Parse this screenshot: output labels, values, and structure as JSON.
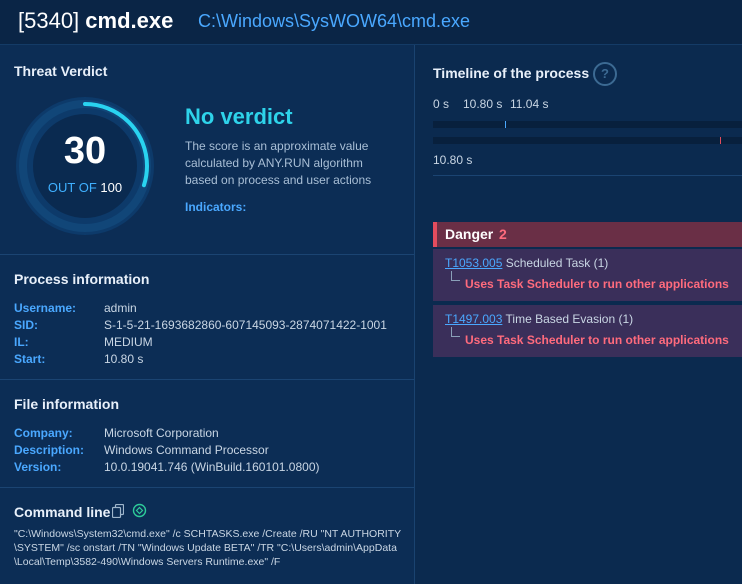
{
  "header": {
    "pid": "[5340]",
    "process_name": "cmd.exe",
    "path": "C:\\Windows\\SysWOW64\\cmd.exe"
  },
  "verdict": {
    "section_title": "Threat Verdict",
    "score": "30",
    "out_of_label": "OUT OF",
    "out_of_value": "100",
    "score_fraction": 0.3,
    "title": "No verdict",
    "description": "The score is an approximate value calculated by ANY.RUN algorithm based on process and user actions",
    "indicators_label": "Indicators:"
  },
  "process_info": {
    "section_title": "Process information",
    "rows": [
      {
        "key": "Username:",
        "value": "admin"
      },
      {
        "key": "SID:",
        "value": "S-1-5-21-1693682860-607145093-2874071422-1001"
      },
      {
        "key": "IL:",
        "value": "MEDIUM"
      },
      {
        "key": "Start:",
        "value": "10.80 s"
      }
    ]
  },
  "file_info": {
    "section_title": "File information",
    "rows": [
      {
        "key": "Company:",
        "value": "Microsoft Corporation"
      },
      {
        "key": "Description:",
        "value": "Windows Command Processor"
      },
      {
        "key": "Version:",
        "value": "10.0.19041.746 (WinBuild.160101.0800)"
      }
    ]
  },
  "command_line": {
    "section_title": "Command line",
    "text": "\"C:\\Windows\\System32\\cmd.exe\" /c SCHTASKS.exe /Create /RU \"NT AUTHORITY\\SYSTEM\" /sc onstart /TN \"Windows Update BETA\" /TR \"C:\\Users\\admin\\AppData\\Local\\Temp\\3582-490\\Windows Servers Runtime.exe\" /F",
    "icons": [
      "copy-icon",
      "chatgpt-icon"
    ]
  },
  "timeline": {
    "title": "Timeline of the process",
    "help_symbol": "?",
    "ticks": [
      "0 s",
      "10.80 s",
      "11.04 s"
    ],
    "footer": "10.80 s"
  },
  "danger": {
    "label": "Danger",
    "count": "2",
    "items": [
      {
        "id": "T1053.005",
        "name": "Scheduled Task (1)",
        "detail": "Uses Task Scheduler to run other applications"
      },
      {
        "id": "T1497.003",
        "name": "Time Based Evasion (1)",
        "detail": "Uses Task Scheduler to run other applications"
      }
    ]
  },
  "colors": {
    "accent": "#2ed3ea",
    "link": "#4aa8ff",
    "danger": "#ff6b7d"
  }
}
